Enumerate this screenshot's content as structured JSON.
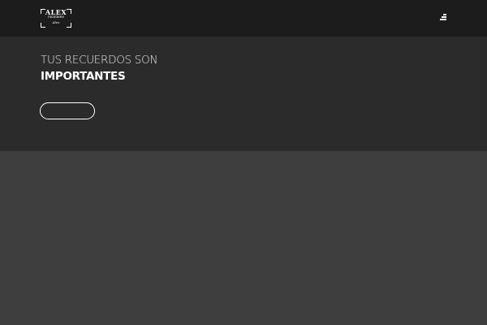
{
  "header": {
    "logo": {
      "name": "ALEX",
      "surname": "nicolaiev",
      "signature": "Alex"
    },
    "menu_icon": "hamburger-menu-icon"
  },
  "hero": {
    "line1": "TUS RECUERDOS SON",
    "line2": "IMPORTANTES",
    "cta_label": ""
  },
  "colors": {
    "header_bg": "#1c1c1c",
    "hero_bg": "#2b2b2b",
    "page_bg": "#3e3e3e",
    "text": "#ffffff"
  }
}
